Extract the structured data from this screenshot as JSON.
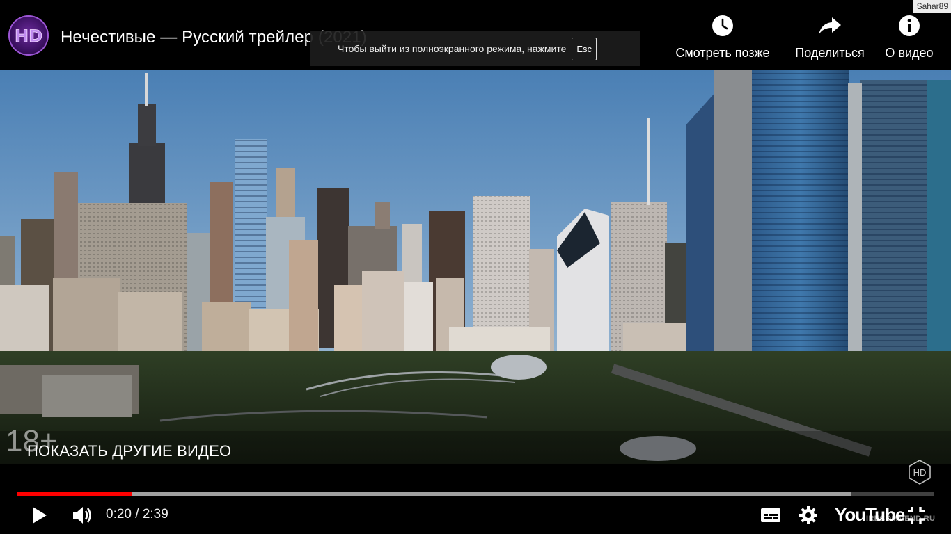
{
  "user": {
    "name": "Sahar89"
  },
  "channel": {
    "logo_text": "HD"
  },
  "video": {
    "title": "Нечестивые — Русский трейлер (2021)",
    "age_rating": "18+",
    "more_videos_label": "ПОКАЗАТЬ ДРУГИЕ ВИДЕО",
    "quality_badge": "HD"
  },
  "actions": {
    "watch_later": {
      "label": "Смотреть позже",
      "icon": "clock-icon"
    },
    "share": {
      "label": "Поделиться",
      "icon": "share-arrow-icon"
    },
    "about": {
      "label": "О видео",
      "icon": "info-icon"
    }
  },
  "fullscreen_toast": {
    "text": "Чтобы выйти из полноэкранного режима, нажмите",
    "key": "Esc"
  },
  "playback": {
    "current_time": "0:20",
    "duration": "2:39",
    "time_display": "0:20 / 2:39",
    "played_fraction": 0.126,
    "buffered_fraction": 0.91,
    "progress_color": "#ff0000"
  },
  "controls": {
    "play": "play-icon",
    "volume": "volume-icon",
    "subtitles": "subtitles-icon",
    "settings": "gear-icon",
    "brand": "YouTube",
    "fullscreen": "exit-fullscreen-icon"
  },
  "watermark": "IRECOMMEND.RU"
}
